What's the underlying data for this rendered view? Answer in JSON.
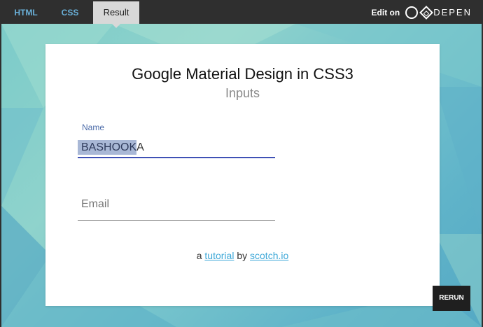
{
  "tabs": [
    {
      "label": "HTML"
    },
    {
      "label": "CSS"
    },
    {
      "label": "Result"
    }
  ],
  "edit_on": {
    "label": "Edit on",
    "brand": "DEPEN"
  },
  "card": {
    "title": "Google Material Design in CSS3",
    "subtitle": "Inputs"
  },
  "form": {
    "name_label": "Name",
    "name_value_selected": "BASHOOK",
    "name_value_rest": "A",
    "email_placeholder": "Email"
  },
  "credit": {
    "prefix": "a",
    "link1": "tutorial",
    "middle": "by",
    "link2": "scotch.io"
  },
  "rerun_label": "RERUN",
  "colors": {
    "accent": "#3f51b5",
    "link": "#3ea8d8",
    "tab_link": "#6ab0d8"
  },
  "icons": {
    "codepen": "codepen-logo-icon"
  }
}
